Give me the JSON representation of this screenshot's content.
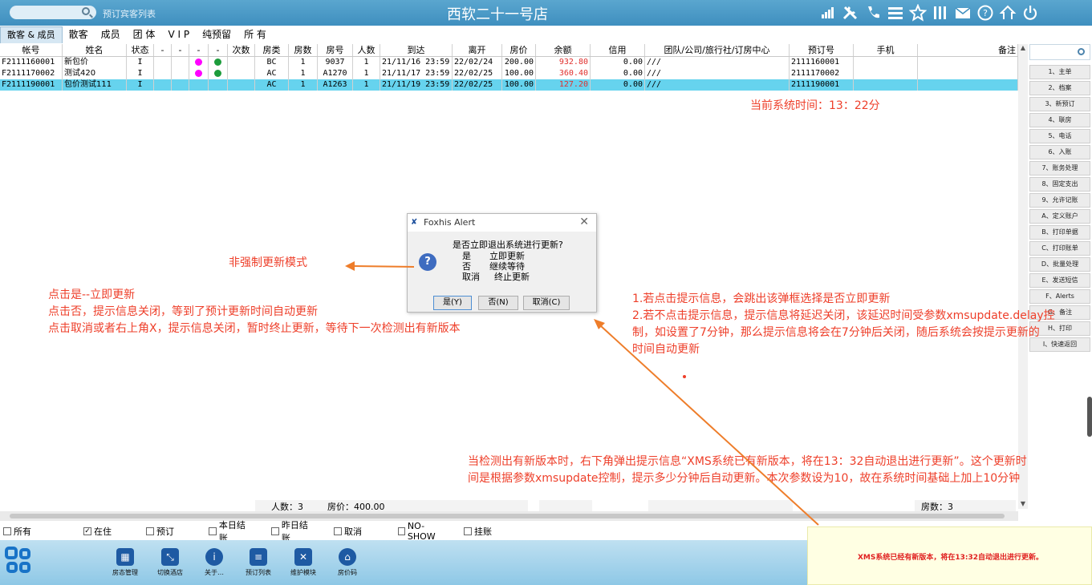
{
  "topbar": {
    "caption": "预订宾客列表",
    "title": "西软二十一号店",
    "icons": [
      "signal-icon",
      "tools-icon",
      "phone-icon",
      "menu-icon",
      "star-icon",
      "bars-icon",
      "mail-icon",
      "help-icon",
      "share-icon",
      "power-icon"
    ]
  },
  "tabs": [
    {
      "label": "散客 & 成员",
      "active": true
    },
    {
      "label": "散客"
    },
    {
      "label": "成员"
    },
    {
      "label": "团 体"
    },
    {
      "label": "V I P"
    },
    {
      "label": "纯预留"
    },
    {
      "label": "所 有"
    }
  ],
  "table": {
    "headers": [
      "帐号",
      "姓名",
      "状态",
      "-",
      "-",
      "-",
      "-",
      "次数",
      "房类",
      "房数",
      "房号",
      "人数",
      "到达",
      "离开",
      "房价",
      "余额",
      "信用",
      "团队/公司/旅行社/订房中心",
      "预订号",
      "手机",
      "备注"
    ],
    "rows": [
      {
        "account": "F2111160001",
        "name": "新包价",
        "status": "I",
        "type": "BC",
        "rooms": "1",
        "room_no": "9037",
        "persons": "1",
        "arrival": "21/11/16 23:59",
        "departure": "22/02/24",
        "rate": "200.00",
        "balance": "932.80",
        "credit": "0.00",
        "group": "///",
        "resv_no": "2111160001",
        "selected": false
      },
      {
        "account": "F2111170002",
        "name": "测试420",
        "status": "I",
        "type": "AC",
        "rooms": "1",
        "room_no": "A1270",
        "persons": "1",
        "arrival": "21/11/17 23:59",
        "departure": "22/02/25",
        "rate": "100.00",
        "balance": "360.40",
        "credit": "0.00",
        "group": "///",
        "resv_no": "2111170002",
        "selected": false
      },
      {
        "account": "F2111190001",
        "name": "包价测试111",
        "status": "I",
        "type": "AC",
        "rooms": "1",
        "room_no": "A1263",
        "persons": "1",
        "arrival": "21/11/19 23:59",
        "departure": "22/02/25",
        "rate": "100.00",
        "balance": "127.20",
        "credit": "0.00",
        "group": "///",
        "resv_no": "2111190001",
        "selected": true
      }
    ]
  },
  "summary": {
    "persons": "人数：3",
    "rate": "房价：400.00",
    "rooms": "房数：3"
  },
  "filters": [
    {
      "label": "所有",
      "checked": false
    },
    {
      "label": "在住",
      "checked": true
    },
    {
      "label": "预订",
      "checked": false
    },
    {
      "label": "本日结账",
      "checked": false
    },
    {
      "label": "昨日结账",
      "checked": false
    },
    {
      "label": "取消",
      "checked": false
    },
    {
      "label": "NO-SHOW",
      "checked": false
    },
    {
      "label": "挂账",
      "checked": false
    }
  ],
  "side_menu": [
    "1、主单",
    "2、档案",
    "3、新预订",
    "4、联房",
    "5、电话",
    "6、入账",
    "7、账务处理",
    "8、固定支出",
    "9、允许记账",
    "A、定义账户",
    "B、打印单据",
    "C、打印账单",
    "D、批量处理",
    "E、发送短信",
    "F、Alerts",
    "G、备注",
    "H、打印",
    "I、快速返回"
  ],
  "bottom_buttons": [
    {
      "label": "房态管理",
      "icon": "room-status-icon"
    },
    {
      "label": "切换酒店",
      "icon": "switch-hotel-icon"
    },
    {
      "label": "关于…",
      "icon": "info-icon"
    },
    {
      "label": "预订列表",
      "icon": "booking-list-icon"
    },
    {
      "label": "维护模块",
      "icon": "maintenance-icon"
    },
    {
      "label": "房价码",
      "icon": "home-icon"
    }
  ],
  "notification": {
    "text": "XMS系统已经有新版本，将在13:32自动退出进行更新。"
  },
  "dialog": {
    "title": "Foxhis Alert",
    "question": "是否立即退出系统进行更新?",
    "lines": [
      {
        "k": "是",
        "v": "立即更新"
      },
      {
        "k": "否",
        "v": "继续等待"
      },
      {
        "k": "取消",
        "v": "终止更新"
      }
    ],
    "btn_yes": "是(Y)",
    "btn_no": "否(N)",
    "btn_cancel": "取消(C)"
  },
  "annotations": {
    "time": "当前系统时间：13：22分",
    "mode": "非强制更新模式",
    "left": [
      "点击是--立即更新",
      "点击否，提示信息关闭，等到了预计更新时间自动更新",
      "点击取消或者右上角X，提示信息关闭，暂时终止更新，等待下一次检测出有新版本"
    ],
    "right": [
      "1.若点击提示信息，会跳出该弹框选择是否立即更新",
      "2.若不点击提示信息，提示信息将延迟关闭，该延迟时间受参数xmsupdate.delay控",
      "制，如设置了7分钟，那么提示信息将会在7分钟后关闭，随后系统会按提示更新的",
      "时间自动更新"
    ],
    "bottom": [
      "当检测出有新版本时，右下角弹出提示信息“XMS系统已有新版本，将在13：32自动退出进行更新”。这个更新时",
      "间是根据参数xmsupdate控制，提示多少分钟后自动更新。本次参数设为10，故在系统时间基础上加上10分钟"
    ]
  },
  "colors": {
    "accent": "#3f8fbf",
    "selected_row": "#66d3ee",
    "annotation": "#ee3f2a"
  }
}
